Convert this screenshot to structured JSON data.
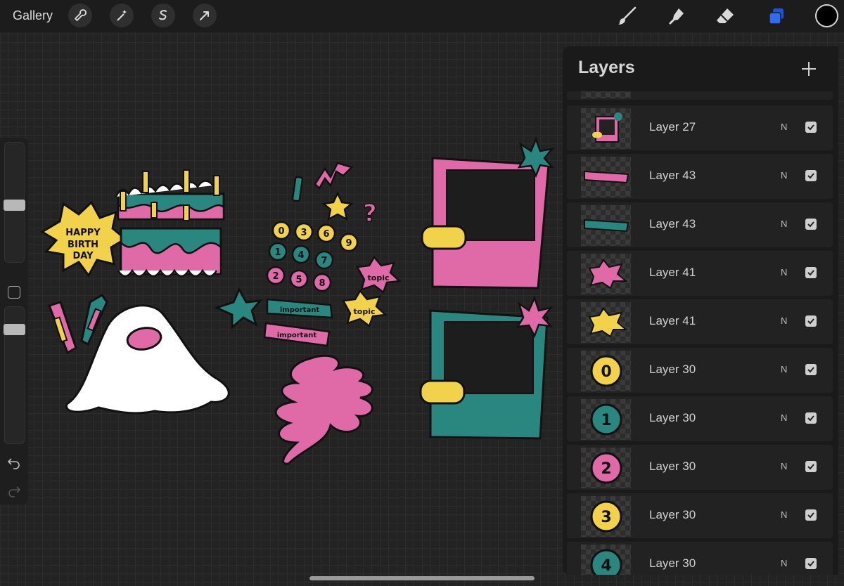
{
  "topbar": {
    "gallery_label": "Gallery",
    "left_tools": [
      "wrench-icon",
      "magic-wand-icon",
      "selection-icon",
      "transform-arrow-icon"
    ],
    "right_tools": [
      "brush-icon",
      "smudge-icon",
      "eraser-icon",
      "layers-icon"
    ],
    "active_tool_color": "#2f6df0",
    "current_color": "#000000"
  },
  "layers_panel": {
    "title": "Layers",
    "add_icon": "plus-icon",
    "layers": [
      {
        "name": "Layer 27",
        "mode": "N",
        "visible": true,
        "thumb": "pink-photo-frame"
      },
      {
        "name": "Layer 43",
        "mode": "N",
        "visible": true,
        "thumb": "pink-important-label"
      },
      {
        "name": "Layer 43",
        "mode": "N",
        "visible": true,
        "thumb": "teal-important-label"
      },
      {
        "name": "Layer 41",
        "mode": "N",
        "visible": true,
        "thumb": "pink-topic-burst"
      },
      {
        "name": "Layer 41",
        "mode": "N",
        "visible": true,
        "thumb": "yellow-topic-burst"
      },
      {
        "name": "Layer 30",
        "mode": "N",
        "visible": true,
        "thumb": "number-0-yellow"
      },
      {
        "name": "Layer 30",
        "mode": "N",
        "visible": true,
        "thumb": "number-1-teal"
      },
      {
        "name": "Layer 30",
        "mode": "N",
        "visible": true,
        "thumb": "number-2-pink"
      },
      {
        "name": "Layer 30",
        "mode": "N",
        "visible": true,
        "thumb": "number-3-yellow"
      },
      {
        "name": "Layer 30",
        "mode": "N",
        "visible": true,
        "thumb": "number-4-teal"
      }
    ]
  },
  "canvas": {
    "birthday_text": [
      "HAPPY",
      "BIRTH",
      "DAY"
    ],
    "important_label": "important",
    "topic_label": "topic",
    "numbers": [
      "0",
      "3",
      "6",
      "9",
      "1",
      "4",
      "7",
      "2",
      "5",
      "8"
    ],
    "question_mark": "?",
    "colors": {
      "pink": "#e06aa8",
      "teal": "#2a8780",
      "yellow": "#f3d24b",
      "white": "#ffffff"
    }
  }
}
